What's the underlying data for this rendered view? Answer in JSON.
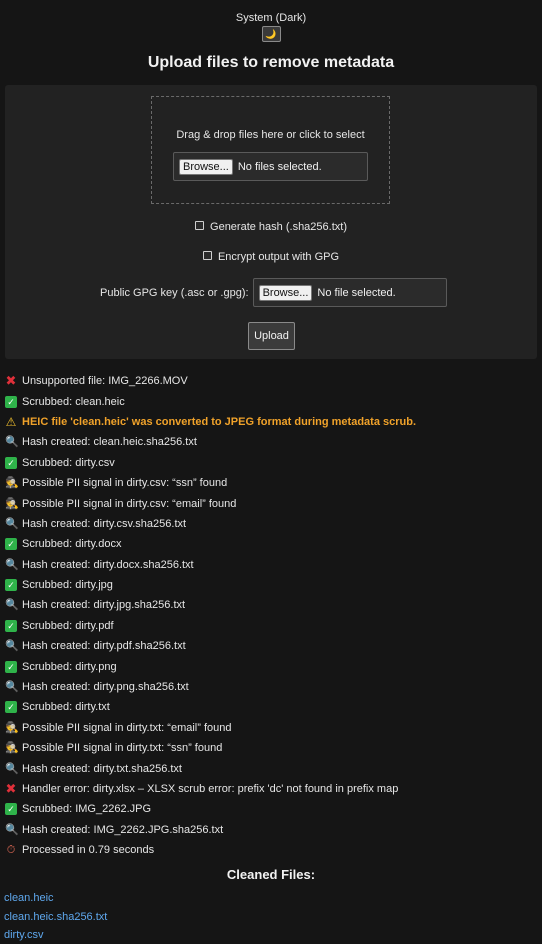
{
  "theme": {
    "label": "System (Dark)",
    "toggle_icon": "moon-icon",
    "toggle_glyph": "🌙"
  },
  "page_title": "Upload files to remove metadata",
  "upload": {
    "dropzone_text": "Drag & drop files here or click to select",
    "browse_label": "Browse...",
    "files_status": "No files selected.",
    "generate_hash_label": "Generate hash (.sha256.txt)",
    "encrypt_label": "Encrypt output with GPG",
    "gpg_key_label": "Public GPG key (.asc or .gpg):",
    "gpg_browse_label": "Browse...",
    "gpg_file_status": "No file selected.",
    "upload_button": "Upload"
  },
  "log": [
    {
      "icon": "cross-icon",
      "glyph": "✖",
      "text": "Unsupported file: IMG_2266.MOV",
      "type": "error"
    },
    {
      "icon": "check-icon",
      "glyph": "✓",
      "text": "Scrubbed: clean.heic",
      "type": "ok"
    },
    {
      "icon": "warning-icon",
      "glyph": "⚠",
      "text": "HEIC file 'clean.heic' was converted to JPEG format during metadata scrub.",
      "type": "warn"
    },
    {
      "icon": "magnifier-icon",
      "glyph": "🔍",
      "text": "Hash created: clean.heic.sha256.txt",
      "type": "hash"
    },
    {
      "icon": "check-icon",
      "glyph": "✓",
      "text": "Scrubbed: dirty.csv",
      "type": "ok"
    },
    {
      "icon": "detective-icon",
      "glyph": "🕵",
      "text": "Possible PII signal in dirty.csv: “ssn” found",
      "type": "pii"
    },
    {
      "icon": "detective-icon",
      "glyph": "🕵",
      "text": "Possible PII signal in dirty.csv: “email” found",
      "type": "pii"
    },
    {
      "icon": "magnifier-icon",
      "glyph": "🔍",
      "text": "Hash created: dirty.csv.sha256.txt",
      "type": "hash"
    },
    {
      "icon": "check-icon",
      "glyph": "✓",
      "text": "Scrubbed: dirty.docx",
      "type": "ok"
    },
    {
      "icon": "magnifier-icon",
      "glyph": "🔍",
      "text": "Hash created: dirty.docx.sha256.txt",
      "type": "hash"
    },
    {
      "icon": "check-icon",
      "glyph": "✓",
      "text": "Scrubbed: dirty.jpg",
      "type": "ok"
    },
    {
      "icon": "magnifier-icon",
      "glyph": "🔍",
      "text": "Hash created: dirty.jpg.sha256.txt",
      "type": "hash"
    },
    {
      "icon": "check-icon",
      "glyph": "✓",
      "text": "Scrubbed: dirty.pdf",
      "type": "ok"
    },
    {
      "icon": "magnifier-icon",
      "glyph": "🔍",
      "text": "Hash created: dirty.pdf.sha256.txt",
      "type": "hash"
    },
    {
      "icon": "check-icon",
      "glyph": "✓",
      "text": "Scrubbed: dirty.png",
      "type": "ok"
    },
    {
      "icon": "magnifier-icon",
      "glyph": "🔍",
      "text": "Hash created: dirty.png.sha256.txt",
      "type": "hash"
    },
    {
      "icon": "check-icon",
      "glyph": "✓",
      "text": "Scrubbed: dirty.txt",
      "type": "ok"
    },
    {
      "icon": "detective-icon",
      "glyph": "🕵",
      "text": "Possible PII signal in dirty.txt: “email” found",
      "type": "pii"
    },
    {
      "icon": "detective-icon",
      "glyph": "🕵",
      "text": "Possible PII signal in dirty.txt: “ssn” found",
      "type": "pii"
    },
    {
      "icon": "magnifier-icon",
      "glyph": "🔍",
      "text": "Hash created: dirty.txt.sha256.txt",
      "type": "hash"
    },
    {
      "icon": "cross-icon",
      "glyph": "✖",
      "text": "Handler error: dirty.xlsx – XLSX scrub error: prefix 'dc' not found in prefix map",
      "type": "error"
    },
    {
      "icon": "check-icon",
      "glyph": "✓",
      "text": "Scrubbed: IMG_2262.JPG",
      "type": "ok"
    },
    {
      "icon": "magnifier-icon",
      "glyph": "🔍",
      "text": "Hash created: IMG_2262.JPG.sha256.txt",
      "type": "hash"
    },
    {
      "icon": "stopwatch-icon",
      "glyph": "⏱",
      "text": "Processed in 0.79 seconds",
      "type": "time"
    }
  ],
  "cleaned": {
    "title": "Cleaned Files:",
    "files": [
      "clean.heic",
      "clean.heic.sha256.txt",
      "dirty.csv"
    ]
  },
  "colors": {
    "background": "#151515",
    "panel": "#222222",
    "link": "#5fa8ee",
    "warning": "#f0a22a",
    "success": "#2fb34a",
    "error": "#e0303a"
  }
}
